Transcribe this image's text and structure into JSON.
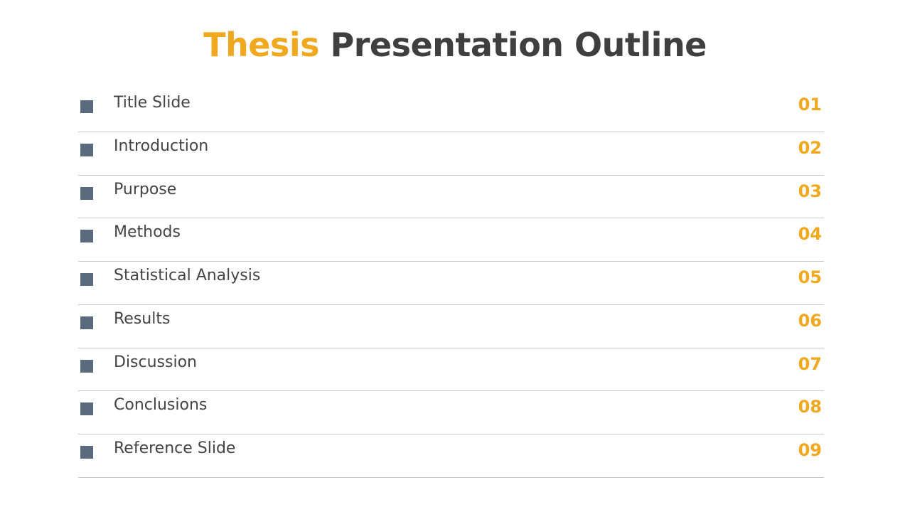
{
  "title": {
    "accent": "Thesis",
    "rest": "Presentation Outline"
  },
  "colors": {
    "accent": "#f0a81e",
    "text": "#3f3f3f",
    "bullet": "#5a6b80"
  },
  "items": [
    {
      "label": "Title Slide",
      "number": "01"
    },
    {
      "label": "Introduction",
      "number": "02"
    },
    {
      "label": "Purpose",
      "number": "03"
    },
    {
      "label": "Methods",
      "number": "04"
    },
    {
      "label": "Statistical Analysis",
      "number": "05"
    },
    {
      "label": "Results",
      "number": "06"
    },
    {
      "label": "Discussion",
      "number": "07"
    },
    {
      "label": "Conclusions",
      "number": "08"
    },
    {
      "label": "Reference Slide",
      "number": "09"
    }
  ]
}
